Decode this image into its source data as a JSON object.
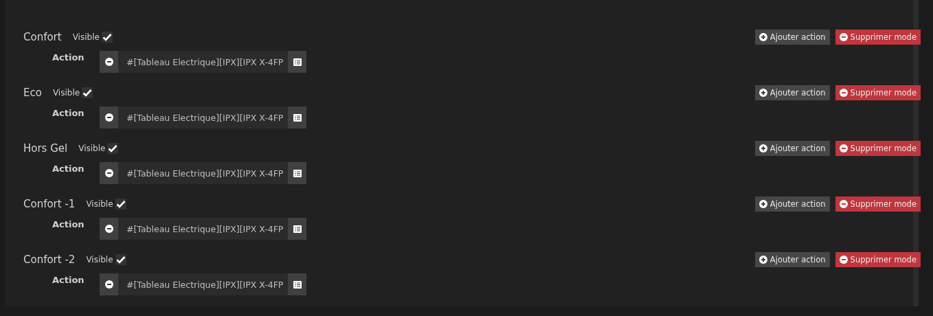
{
  "modes": [
    {
      "name": "Confort",
      "visible_label": "Visible",
      "visible": true,
      "action_label": "Action",
      "action_value": "#[Tableau Electrique][IPX][IPX X-4FP",
      "add_button": "Ajouter action",
      "delete_button": "Supprimer mode"
    },
    {
      "name": "Eco",
      "visible_label": "Visible",
      "visible": true,
      "action_label": "Action",
      "action_value": "#[Tableau Electrique][IPX][IPX X-4FP",
      "add_button": "Ajouter action",
      "delete_button": "Supprimer mode"
    },
    {
      "name": "Hors Gel",
      "visible_label": "Visible",
      "visible": true,
      "action_label": "Action",
      "action_value": "#[Tableau Electrique][IPX][IPX X-4FP",
      "add_button": "Ajouter action",
      "delete_button": "Supprimer mode"
    },
    {
      "name": "Confort -1",
      "visible_label": "Visible",
      "visible": true,
      "action_label": "Action",
      "action_value": "#[Tableau Electrique][IPX][IPX X-4FP",
      "add_button": "Ajouter action",
      "delete_button": "Supprimer mode"
    },
    {
      "name": "Confort -2",
      "visible_label": "Visible",
      "visible": true,
      "action_label": "Action",
      "action_value": "#[Tableau Electrique][IPX][IPX X-4FP",
      "add_button": "Ajouter action",
      "delete_button": "Supprimer mode"
    }
  ]
}
